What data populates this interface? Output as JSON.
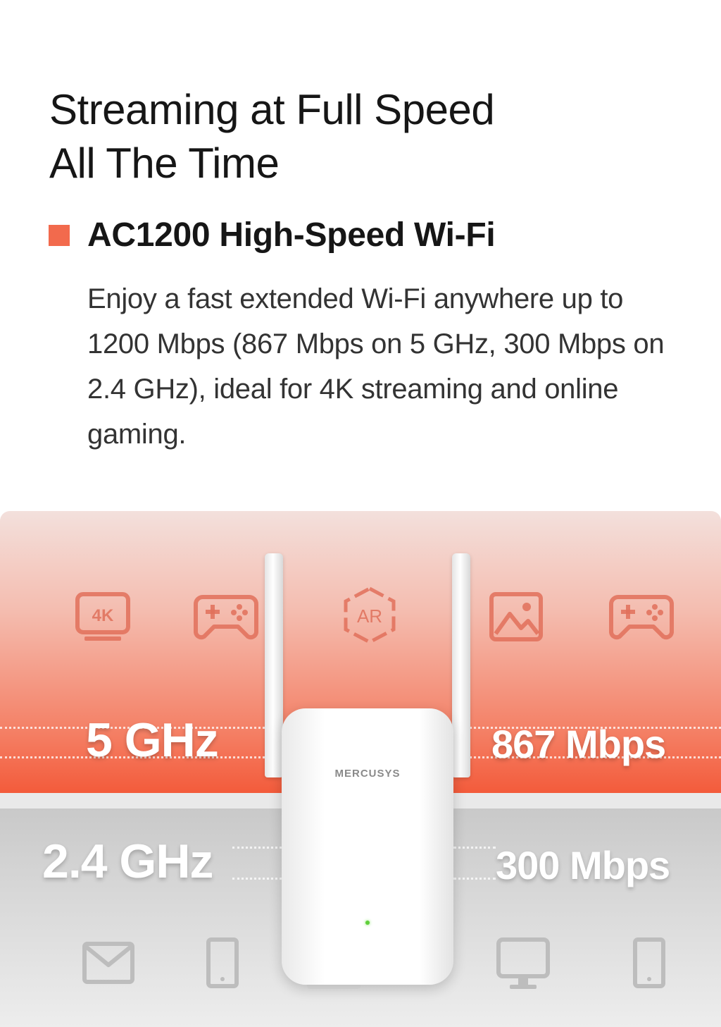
{
  "headline": {
    "line1": "Streaming at Full Speed",
    "line2": "All The Time"
  },
  "feature": {
    "title": "AC1200 High-Speed Wi-Fi",
    "description": "Enjoy a fast extended Wi-Fi anywhere up to 1200 Mbps (867 Mbps on 5 GHz, 300 Mbps on 2.4 GHz), ideal for 4K streaming and online gaming.",
    "bullet_color": "#f26a4d"
  },
  "graphic": {
    "band_5ghz": {
      "label": "5 GHz",
      "speed": "867 Mbps",
      "color": "#f35b3b"
    },
    "band_24ghz": {
      "label": "2.4 GHz",
      "speed": "300 Mbps",
      "color": "#cfcfcf"
    },
    "top_icons": [
      {
        "name": "4k-tv-icon",
        "text": "4K"
      },
      {
        "name": "gamepad-icon"
      },
      {
        "name": "ar-icon",
        "text": "AR"
      },
      {
        "name": "image-icon"
      },
      {
        "name": "gamepad-icon"
      }
    ],
    "bottom_icons": [
      {
        "name": "mail-icon"
      },
      {
        "name": "tablet-icon"
      },
      {
        "name": "monitor-icon"
      },
      {
        "name": "tablet-icon"
      }
    ],
    "device": {
      "brand": "MERCUSYS"
    }
  }
}
